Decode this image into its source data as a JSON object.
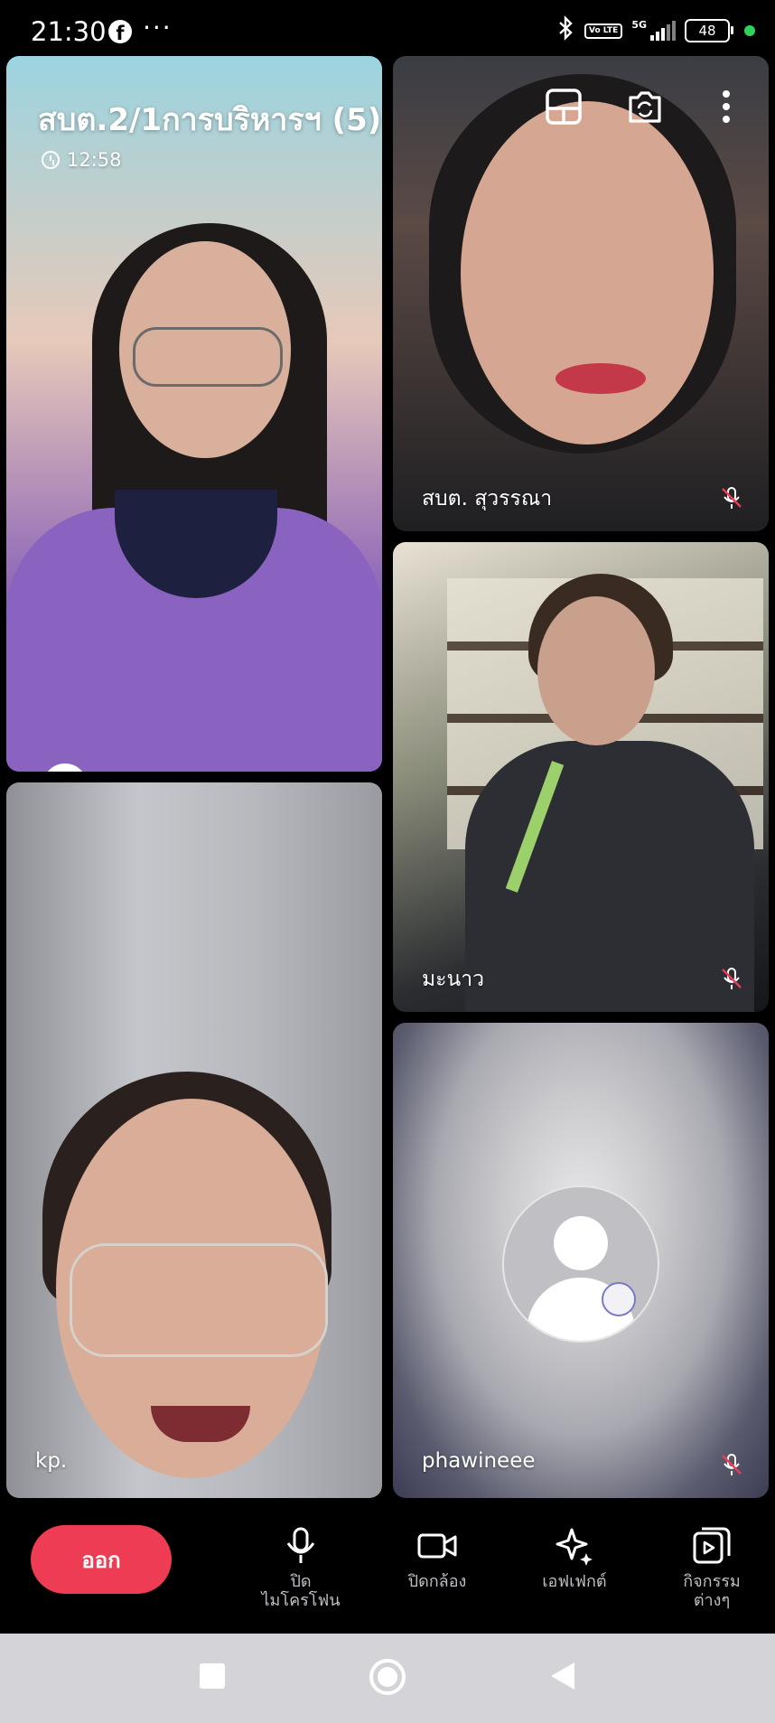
{
  "status_bar": {
    "time": "21:30",
    "app_icon": "facebook-icon",
    "more_dots": "···",
    "network": "5G",
    "volte": "Vo LTE",
    "battery": "48"
  },
  "call": {
    "title": "สบต.2/1การบริหารฯ (5)",
    "duration": "12:58"
  },
  "participants": [
    {
      "name": ""
    },
    {
      "name": "สบต. สุวรรณา"
    },
    {
      "name": "kp."
    },
    {
      "name": "มะนาว"
    },
    {
      "name": "phawineee"
    }
  ],
  "controls": {
    "leave": "ออก",
    "mic": "ปิด\nไมโครโฟน",
    "camera": "ปิดกล้อง",
    "effects": "เอฟเฟกต์",
    "activities": "กิจกรรม\nต่างๆ"
  },
  "colors": {
    "leave_button": "#ee3c55",
    "control_label": "#bfbfc4",
    "nav_bar": "#d4d4d8"
  }
}
